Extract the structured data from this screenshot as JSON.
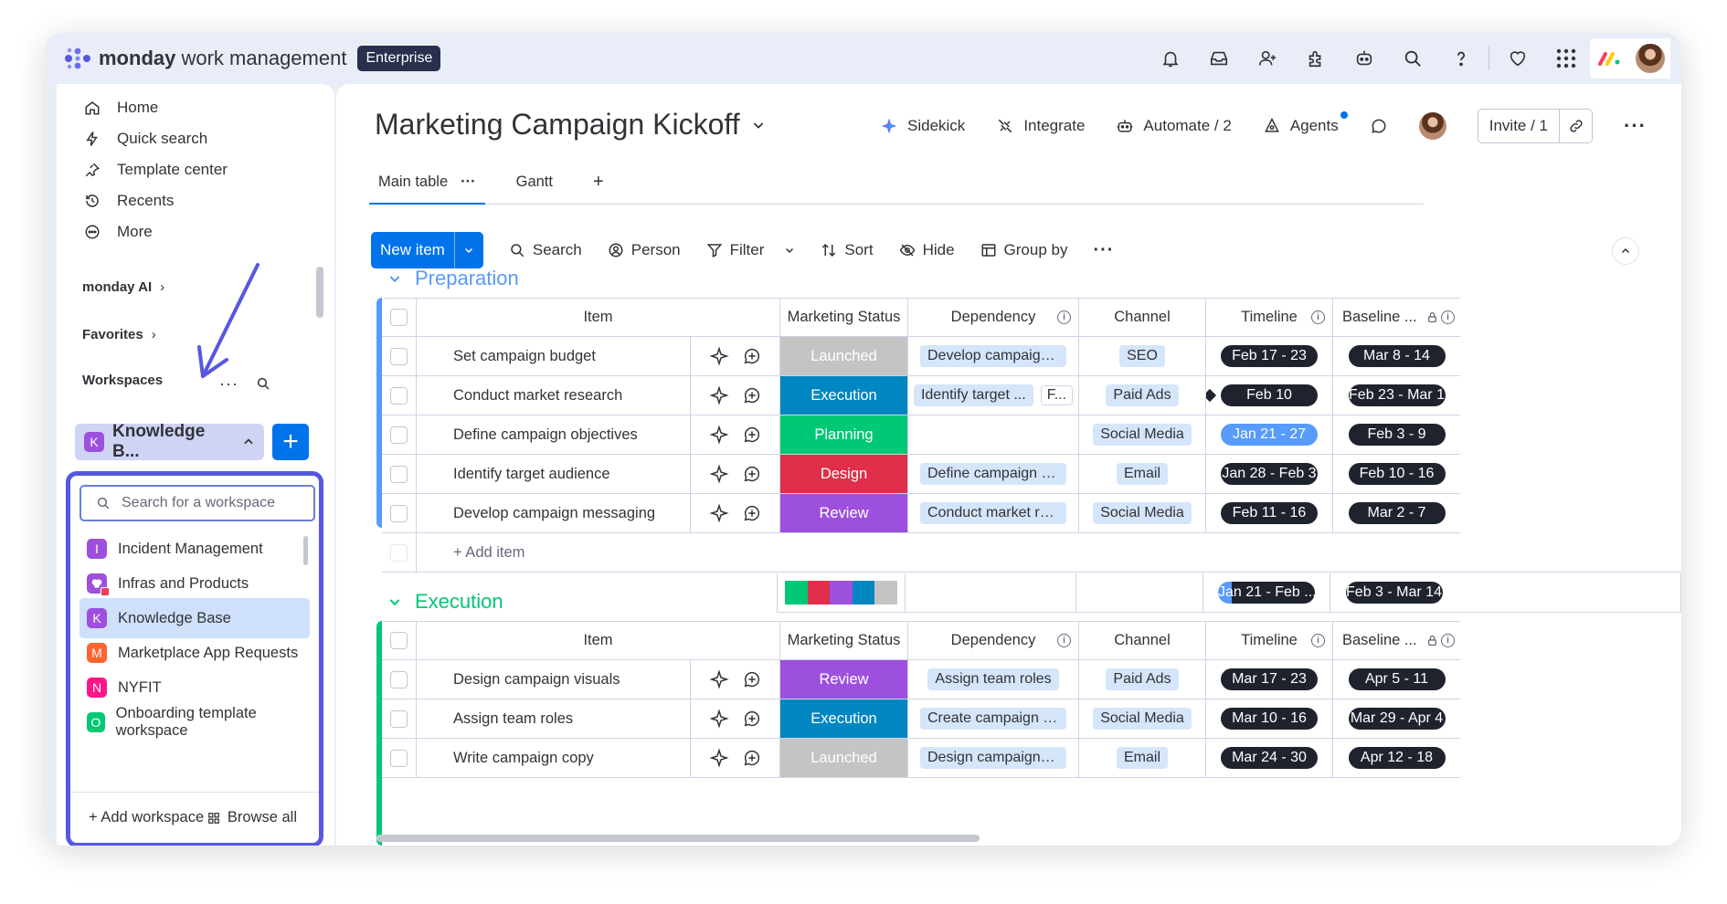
{
  "app": {
    "brand": "monday",
    "product": " work management",
    "plan_badge": "Enterprise"
  },
  "top_icons": [
    "bell-icon",
    "inbox-icon",
    "invite-members-icon",
    "apps-icon",
    "ai-bot-icon",
    "search-icon",
    "help-icon",
    "favorites-heart-icon",
    "apps-grid-icon",
    "monday-logo-icon",
    "user-avatar"
  ],
  "sidebar": {
    "nav": [
      {
        "label": "Home",
        "icon": "home-icon"
      },
      {
        "label": "Quick search",
        "icon": "lightning-icon"
      },
      {
        "label": "Template center",
        "icon": "pin-icon"
      },
      {
        "label": "Recents",
        "icon": "history-icon"
      },
      {
        "label": "More",
        "icon": "more-circle-icon"
      }
    ],
    "monday_ai": "monday AI",
    "favorites": "Favorites",
    "workspaces": "Workspaces",
    "current_workspace": {
      "initial": "K",
      "name": "Knowledge B..."
    },
    "add": "+"
  },
  "workspace_panel": {
    "search_placeholder": "Search for a workspace",
    "items": [
      {
        "initial": "I",
        "name": "Incident Management",
        "color": "#9d50dd"
      },
      {
        "initial": "",
        "name": "Infras and Products",
        "color": "#e44258"
      },
      {
        "initial": "K",
        "name": "Knowledge Base",
        "color": "#9d50dd",
        "active": true
      },
      {
        "initial": "M",
        "name": "Marketplace App Requests",
        "color": "#ff642e"
      },
      {
        "initial": "N",
        "name": "NYFIT",
        "color": "#ff158a"
      },
      {
        "initial": "O",
        "name": "Onboarding template workspace",
        "color": "#00c875"
      }
    ],
    "add_workspace": "+ Add workspace",
    "browse_all": "Browse all"
  },
  "board": {
    "title": "Marketing Campaign Kickoff",
    "actions": {
      "sidekick": "Sidekick",
      "integrate": "Integrate",
      "automate": "Automate / 2",
      "agents": "Agents",
      "invite": "Invite / 1"
    },
    "tabs": {
      "main": "Main table",
      "gantt": "Gantt",
      "add": "+"
    },
    "toolbar": {
      "new_item": "New item",
      "search": "Search",
      "person": "Person",
      "filter": "Filter",
      "sort": "Sort",
      "hide": "Hide",
      "group_by": "Group by"
    },
    "columns": {
      "item": "Item",
      "status": "Marketing Status",
      "dependency": "Dependency",
      "channel": "Channel",
      "timeline": "Timeline",
      "baseline": "Baseline ..."
    },
    "groups": [
      {
        "title": "Preparation",
        "color": "#579bfc",
        "rows": [
          {
            "item": "Set campaign budget",
            "status": "Launched",
            "status_color": "#c4c4c4",
            "dependency": "Develop campaign m...",
            "channel": "SEO",
            "timeline": "Feb 17 - 23",
            "baseline": "Mar 8 - 14"
          },
          {
            "item": "Conduct market research",
            "status": "Execution",
            "status_color": "#0086c0",
            "dependency": "Identify target ...",
            "dependency_extra": "F...",
            "channel": "Paid Ads",
            "timeline": "Feb 10",
            "baseline": "Feb 23 - Mar 1"
          },
          {
            "item": "Define campaign objectives",
            "status": "Planning",
            "status_color": "#00c875",
            "dependency": "",
            "channel": "Social Media",
            "timeline": "Jan 21 - 27",
            "timeline_blue": true,
            "baseline": "Feb 3 - 9"
          },
          {
            "item": "Identify target audience",
            "status": "Design",
            "status_color": "#df2f4a",
            "dependency": "Define campaign obj...",
            "channel": "Email",
            "timeline": "Jan 28 - Feb 3",
            "baseline": "Feb 10 - 16"
          },
          {
            "item": "Develop campaign messaging",
            "status": "Review",
            "status_color": "#9d50dd",
            "dependency": "Conduct market rese...",
            "channel": "Social Media",
            "timeline": "Feb 11 - 16",
            "baseline": "Mar 2 - 7"
          }
        ],
        "add_item": "+ Add item",
        "summary": {
          "timeline": "Jan 21 - Feb ...",
          "baseline": "Feb 3 - Mar 14",
          "status_colors": [
            "#00c875",
            "#df2f4a",
            "#9d50dd",
            "#0086c0",
            "#c4c4c4"
          ]
        }
      },
      {
        "title": "Execution",
        "color": "#00c875",
        "rows": [
          {
            "item": "Design campaign visuals",
            "status": "Review",
            "status_color": "#9d50dd",
            "dependency": "Assign team roles",
            "channel": "Paid Ads",
            "timeline": "Mar 17 - 23",
            "baseline": "Apr 5 - 11"
          },
          {
            "item": "Assign team roles",
            "status": "Execution",
            "status_color": "#0086c0",
            "dependency": "Create campaign tim...",
            "channel": "Social Media",
            "timeline": "Mar 10 - 16",
            "baseline": "Mar 29 - Apr 4"
          },
          {
            "item": "Write campaign copy",
            "status": "Launched",
            "status_color": "#c4c4c4",
            "dependency": "Design campaign visu...",
            "channel": "Email",
            "timeline": "Mar 24 - 30",
            "baseline": "Apr 12 - 18"
          }
        ]
      }
    ]
  }
}
